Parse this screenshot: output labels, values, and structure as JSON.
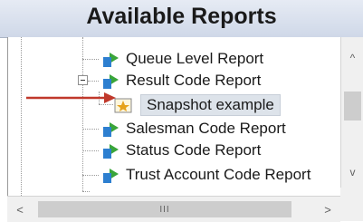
{
  "header": {
    "title": "Available Reports"
  },
  "tree": {
    "items": [
      {
        "label": "Queue Level Report",
        "icon": "report-icon"
      },
      {
        "label": "Result Code Report",
        "icon": "report-icon",
        "expanded": true
      },
      {
        "label": "Snapshot example",
        "icon": "snapshot-icon",
        "selected": true
      },
      {
        "label": "Salesman Code Report",
        "icon": "report-icon"
      },
      {
        "label": "Status Code Report",
        "icon": "report-icon"
      },
      {
        "label": "Trust Account Code Report",
        "icon": "report-icon"
      }
    ]
  },
  "scrollbars": {
    "vertical": {
      "up_glyph": "^",
      "down_glyph": "v"
    },
    "horizontal": {
      "left_glyph": "<",
      "right_glyph": ">",
      "thumb_grip": "III"
    }
  },
  "colors": {
    "header_gradient_top": "#e6ebf4",
    "header_gradient_bottom": "#cfd8e8",
    "selection_bg": "#dde3ea",
    "arrow": "#c0392b",
    "icon_green": "#3aa53a",
    "icon_blue": "#2d7fd0",
    "snapshot_star": "#e6a21a"
  }
}
